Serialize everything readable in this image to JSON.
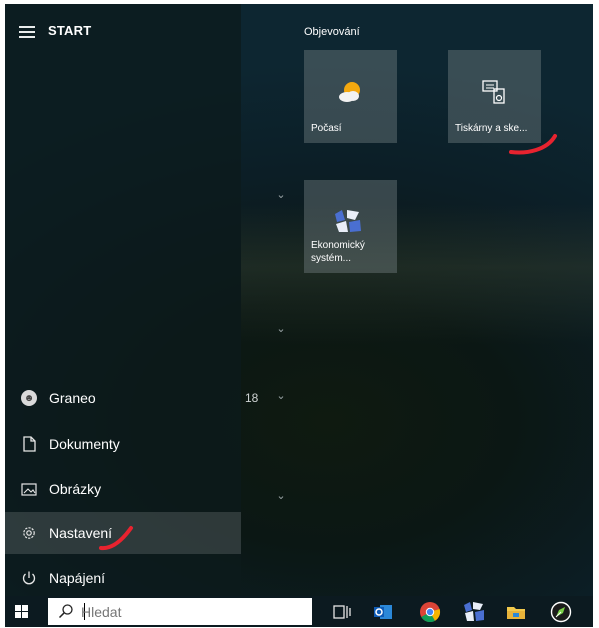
{
  "start_menu": {
    "title": "START",
    "nav": [
      {
        "label": "Graneo",
        "icon": "user-avatar-icon"
      },
      {
        "label": "Dokumenty",
        "icon": "document-icon"
      },
      {
        "label": "Obrázky",
        "icon": "pictures-icon"
      },
      {
        "label": "Nastavení",
        "icon": "gear-icon",
        "active": true
      },
      {
        "label": "Napájení",
        "icon": "power-icon"
      }
    ],
    "list_fragment": "18"
  },
  "tiles": {
    "group_title": "Objevování",
    "items": [
      {
        "label": "Počasí",
        "icon": "weather-icon"
      },
      {
        "label": "Tiskárny a ske...",
        "icon": "printer-scanner-icon"
      },
      {
        "label": "Ekonomický systém...",
        "icon": "economic-system-icon"
      }
    ]
  },
  "taskbar": {
    "search_placeholder": "Hledat",
    "apps": [
      "task-view-icon",
      "outlook-icon",
      "chrome-icon",
      "economic-system-icon",
      "file-explorer-icon",
      "pen-app-icon"
    ]
  },
  "colors": {
    "annotation": "#e8232f",
    "tile_background": "#7c8587",
    "taskbar": "#0c1a20"
  }
}
